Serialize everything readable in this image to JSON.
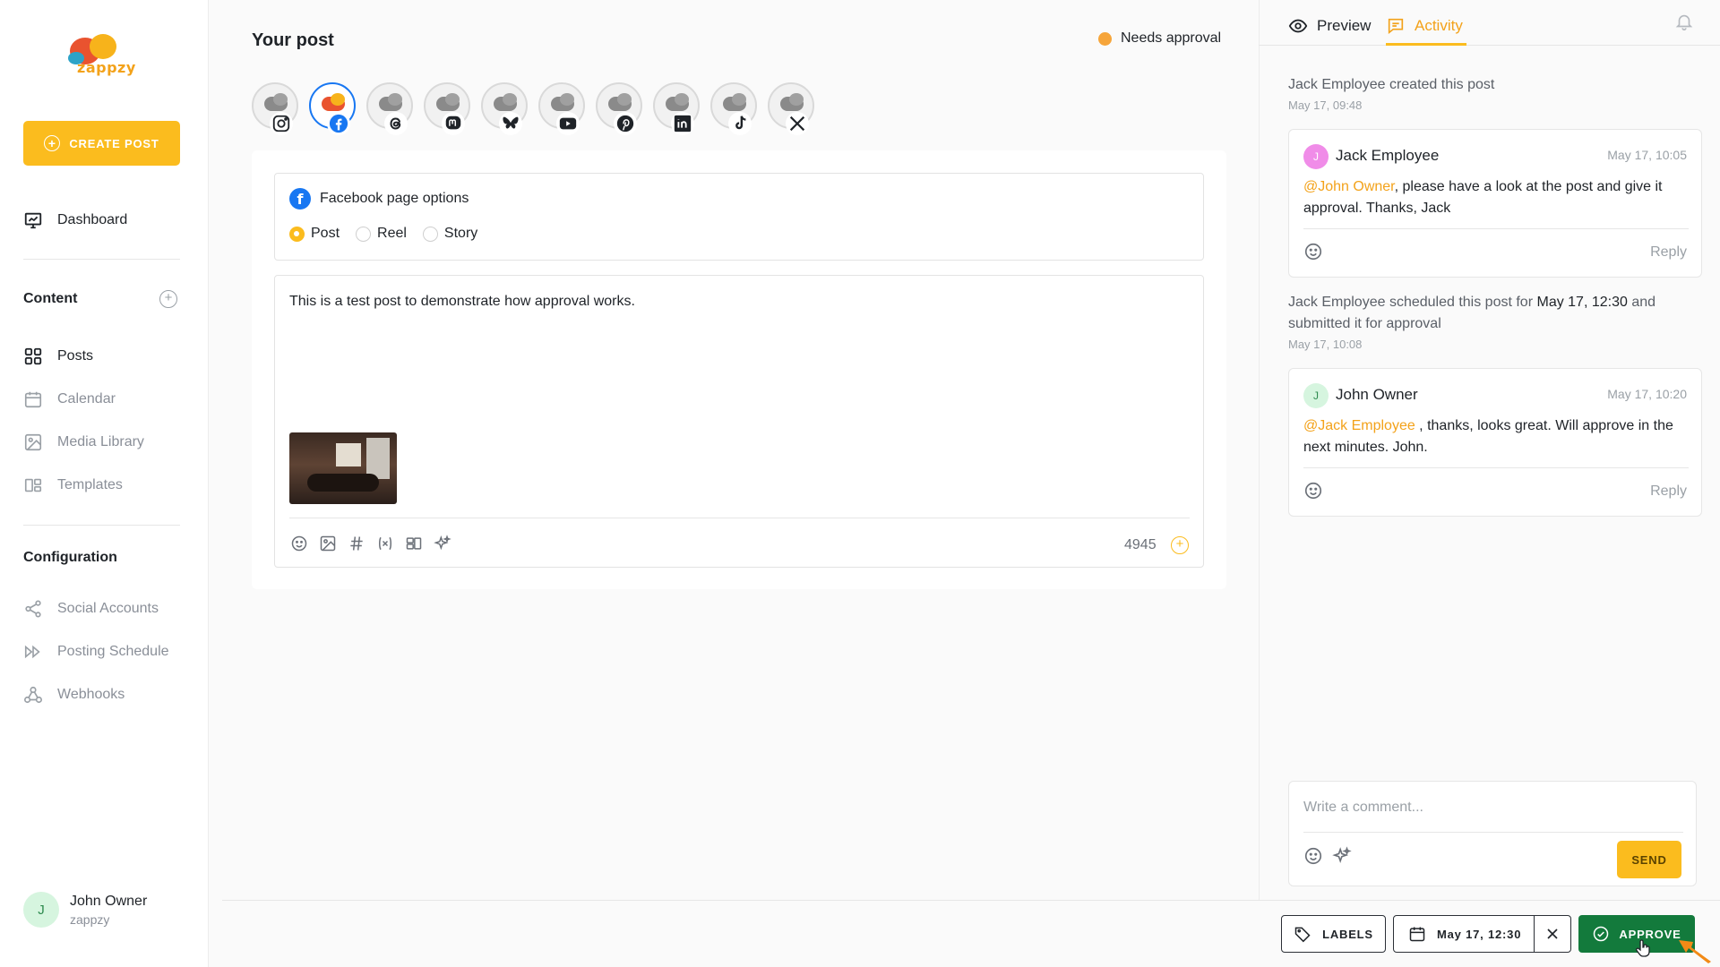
{
  "brand": {
    "name": "zappzy"
  },
  "sidebar": {
    "create_post": "CREATE POST",
    "dashboard": "Dashboard",
    "content_title": "Content",
    "content_items": [
      {
        "label": "Posts",
        "icon": "grid-icon"
      },
      {
        "label": "Calendar",
        "icon": "calendar-icon"
      },
      {
        "label": "Media Library",
        "icon": "image-icon"
      },
      {
        "label": "Templates",
        "icon": "templates-icon"
      }
    ],
    "config_title": "Configuration",
    "config_items": [
      {
        "label": "Social Accounts",
        "icon": "share-icon"
      },
      {
        "label": "Posting Schedule",
        "icon": "schedule-icon"
      },
      {
        "label": "Webhooks",
        "icon": "webhook-icon"
      }
    ],
    "user": {
      "initial": "J",
      "name": "John Owner",
      "org": "zappzy"
    }
  },
  "main": {
    "title": "Your post",
    "status": "Needs approval",
    "status_color": "#f6a53a",
    "channels": [
      "instagram-icon",
      "facebook-icon",
      "threads-icon",
      "mastodon-icon",
      "bluesky-icon",
      "youtube-icon",
      "pinterest-icon",
      "linkedin-icon",
      "tiktok-icon",
      "x-icon"
    ],
    "fb_options": {
      "title": "Facebook page options",
      "options": [
        "Post",
        "Reel",
        "Story"
      ],
      "selected": "Post"
    },
    "post_text": "This is a test post to demonstrate how approval works.",
    "char_count": "4945"
  },
  "panel": {
    "tab_preview": "Preview",
    "tab_activity": "Activity",
    "activity": [
      {
        "text": "Jack Employee created this post",
        "time": "May 17, 09:48"
      }
    ],
    "comment1": {
      "initial": "J",
      "name": "Jack Employee",
      "time": "May 17, 10:05",
      "mention": "@John Owner",
      "body": ", please have a look at the post and give it approval. Thanks, Jack",
      "reply": "Reply"
    },
    "activity2": {
      "prefix": "Jack Employee scheduled this post for ",
      "date": "May 17, 12:30",
      "suffix": " and submitted it for approval",
      "time": "May 17, 10:08"
    },
    "comment2": {
      "initial": "J",
      "name": "John Owner",
      "time": "May 17, 10:20",
      "mention": "@Jack Employee",
      "body": " , thanks, looks great. Will approve in the next minutes. John.",
      "reply": "Reply"
    },
    "compose_placeholder": "Write a comment...",
    "send": "SEND"
  },
  "bottom": {
    "labels": "LABELS",
    "date": "May 17, 12:30",
    "approve": "APPROVE"
  },
  "colors": {
    "accent": "#fbbc1e",
    "approve": "#137a3c",
    "mention": "#f3a21a"
  }
}
